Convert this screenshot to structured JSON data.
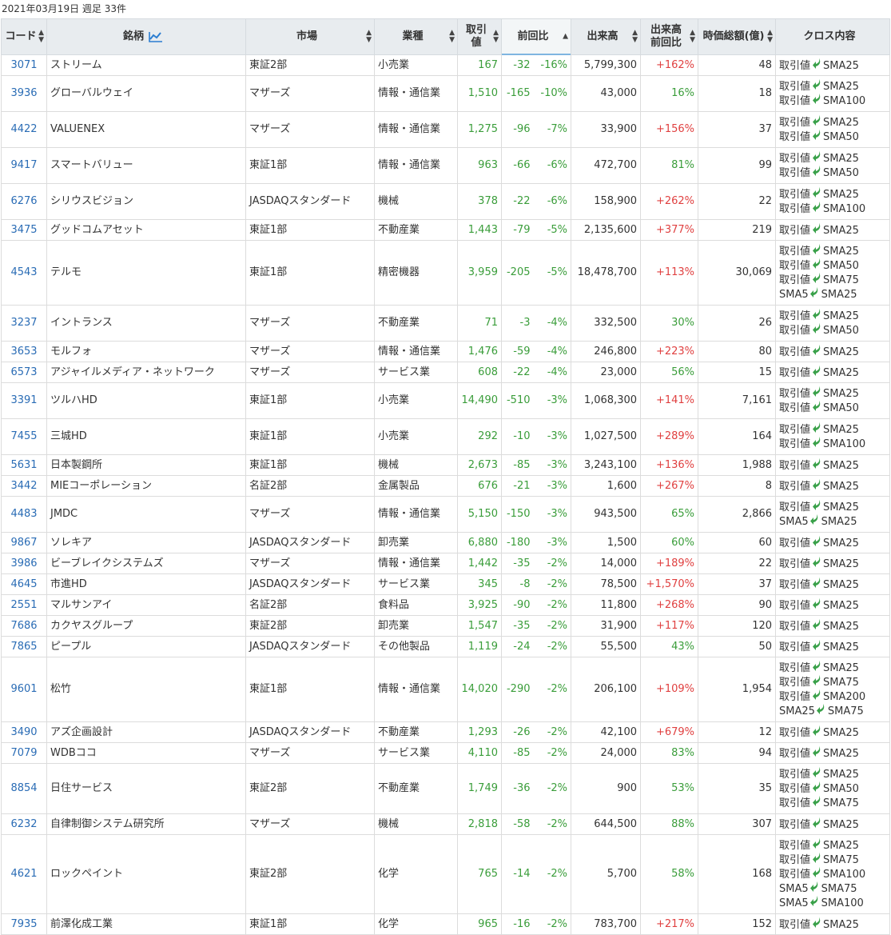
{
  "caption": "2021年03月19日 週足 33件",
  "headers": {
    "code": "コード",
    "name": "銘柄",
    "market": "市場",
    "industry": "業種",
    "price": "取引値",
    "change": "前回比",
    "volume": "出来高",
    "vol_ratio_1": "出来高",
    "vol_ratio_2": "前回比",
    "mcap": "時価総額(億)",
    "cross": "クロス内容"
  },
  "arrow_color": "#3aa14a",
  "rows": [
    {
      "code": "3071",
      "name": "ストリーム",
      "market": "東証2部",
      "industry": "小売業",
      "price": "167",
      "chg": "-32",
      "chgpct": "-16%",
      "volume": "5,799,300",
      "volratio": "+162%",
      "mcap": "48",
      "cross": [
        [
          "取引値",
          "SMA25"
        ]
      ]
    },
    {
      "code": "3936",
      "name": "グローバルウェイ",
      "market": "マザーズ",
      "industry": "情報・通信業",
      "price": "1,510",
      "chg": "-165",
      "chgpct": "-10%",
      "volume": "43,000",
      "volratio": "16%",
      "mcap": "18",
      "cross": [
        [
          "取引値",
          "SMA25"
        ],
        [
          "取引値",
          "SMA100"
        ]
      ]
    },
    {
      "code": "4422",
      "name": "VALUENEX",
      "market": "マザーズ",
      "industry": "情報・通信業",
      "price": "1,275",
      "chg": "-96",
      "chgpct": "-7%",
      "volume": "33,900",
      "volratio": "+156%",
      "mcap": "37",
      "cross": [
        [
          "取引値",
          "SMA25"
        ],
        [
          "取引値",
          "SMA50"
        ]
      ]
    },
    {
      "code": "9417",
      "name": "スマートバリュー",
      "market": "東証1部",
      "industry": "情報・通信業",
      "price": "963",
      "chg": "-66",
      "chgpct": "-6%",
      "volume": "472,700",
      "volratio": "81%",
      "mcap": "99",
      "cross": [
        [
          "取引値",
          "SMA25"
        ],
        [
          "取引値",
          "SMA50"
        ]
      ]
    },
    {
      "code": "6276",
      "name": "シリウスビジョン",
      "market": "JASDAQスタンダード",
      "industry": "機械",
      "price": "378",
      "chg": "-22",
      "chgpct": "-6%",
      "volume": "158,900",
      "volratio": "+262%",
      "mcap": "22",
      "cross": [
        [
          "取引値",
          "SMA25"
        ],
        [
          "取引値",
          "SMA100"
        ]
      ]
    },
    {
      "code": "3475",
      "name": "グッドコムアセット",
      "market": "東証1部",
      "industry": "不動産業",
      "price": "1,443",
      "chg": "-79",
      "chgpct": "-5%",
      "volume": "2,135,600",
      "volratio": "+377%",
      "mcap": "219",
      "cross": [
        [
          "取引値",
          "SMA25"
        ]
      ]
    },
    {
      "code": "4543",
      "name": "テルモ",
      "market": "東証1部",
      "industry": "精密機器",
      "price": "3,959",
      "chg": "-205",
      "chgpct": "-5%",
      "volume": "18,478,700",
      "volratio": "+113%",
      "mcap": "30,069",
      "cross": [
        [
          "取引値",
          "SMA25"
        ],
        [
          "取引値",
          "SMA50"
        ],
        [
          "取引値",
          "SMA75"
        ],
        [
          "SMA5",
          "SMA25"
        ]
      ]
    },
    {
      "code": "3237",
      "name": "イントランス",
      "market": "マザーズ",
      "industry": "不動産業",
      "price": "71",
      "chg": "-3",
      "chgpct": "-4%",
      "volume": "332,500",
      "volratio": "30%",
      "mcap": "26",
      "cross": [
        [
          "取引値",
          "SMA25"
        ],
        [
          "取引値",
          "SMA50"
        ]
      ]
    },
    {
      "code": "3653",
      "name": "モルフォ",
      "market": "マザーズ",
      "industry": "情報・通信業",
      "price": "1,476",
      "chg": "-59",
      "chgpct": "-4%",
      "volume": "246,800",
      "volratio": "+223%",
      "mcap": "80",
      "cross": [
        [
          "取引値",
          "SMA25"
        ]
      ]
    },
    {
      "code": "6573",
      "name": "アジャイルメディア・ネットワーク",
      "market": "マザーズ",
      "industry": "サービス業",
      "price": "608",
      "chg": "-22",
      "chgpct": "-4%",
      "volume": "23,000",
      "volratio": "56%",
      "mcap": "15",
      "cross": [
        [
          "取引値",
          "SMA25"
        ]
      ]
    },
    {
      "code": "3391",
      "name": "ツルハHD",
      "market": "東証1部",
      "industry": "小売業",
      "price": "14,490",
      "chg": "-510",
      "chgpct": "-3%",
      "volume": "1,068,300",
      "volratio": "+141%",
      "mcap": "7,161",
      "cross": [
        [
          "取引値",
          "SMA25"
        ],
        [
          "取引値",
          "SMA50"
        ]
      ]
    },
    {
      "code": "7455",
      "name": "三城HD",
      "market": "東証1部",
      "industry": "小売業",
      "price": "292",
      "chg": "-10",
      "chgpct": "-3%",
      "volume": "1,027,500",
      "volratio": "+289%",
      "mcap": "164",
      "cross": [
        [
          "取引値",
          "SMA25"
        ],
        [
          "取引値",
          "SMA100"
        ]
      ]
    },
    {
      "code": "5631",
      "name": "日本製鋼所",
      "market": "東証1部",
      "industry": "機械",
      "price": "2,673",
      "chg": "-85",
      "chgpct": "-3%",
      "volume": "3,243,100",
      "volratio": "+136%",
      "mcap": "1,988",
      "cross": [
        [
          "取引値",
          "SMA25"
        ]
      ]
    },
    {
      "code": "3442",
      "name": "MIEコーポレーション",
      "market": "名証2部",
      "industry": "金属製品",
      "price": "676",
      "chg": "-21",
      "chgpct": "-3%",
      "volume": "1,600",
      "volratio": "+267%",
      "mcap": "8",
      "cross": [
        [
          "取引値",
          "SMA25"
        ]
      ]
    },
    {
      "code": "4483",
      "name": "JMDC",
      "market": "マザーズ",
      "industry": "情報・通信業",
      "price": "5,150",
      "chg": "-150",
      "chgpct": "-3%",
      "volume": "943,500",
      "volratio": "65%",
      "mcap": "2,866",
      "cross": [
        [
          "取引値",
          "SMA25"
        ],
        [
          "SMA5",
          "SMA25"
        ]
      ]
    },
    {
      "code": "9867",
      "name": "ソレキア",
      "market": "JASDAQスタンダード",
      "industry": "卸売業",
      "price": "6,880",
      "chg": "-180",
      "chgpct": "-3%",
      "volume": "1,500",
      "volratio": "60%",
      "mcap": "60",
      "cross": [
        [
          "取引値",
          "SMA25"
        ]
      ]
    },
    {
      "code": "3986",
      "name": "ビーブレイクシステムズ",
      "market": "マザーズ",
      "industry": "情報・通信業",
      "price": "1,442",
      "chg": "-35",
      "chgpct": "-2%",
      "volume": "14,000",
      "volratio": "+189%",
      "mcap": "22",
      "cross": [
        [
          "取引値",
          "SMA25"
        ]
      ]
    },
    {
      "code": "4645",
      "name": "市進HD",
      "market": "JASDAQスタンダード",
      "industry": "サービス業",
      "price": "345",
      "chg": "-8",
      "chgpct": "-2%",
      "volume": "78,500",
      "volratio": "+1,570%",
      "mcap": "37",
      "cross": [
        [
          "取引値",
          "SMA25"
        ]
      ]
    },
    {
      "code": "2551",
      "name": "マルサンアイ",
      "market": "名証2部",
      "industry": "食料品",
      "price": "3,925",
      "chg": "-90",
      "chgpct": "-2%",
      "volume": "11,800",
      "volratio": "+268%",
      "mcap": "90",
      "cross": [
        [
          "取引値",
          "SMA25"
        ]
      ]
    },
    {
      "code": "7686",
      "name": "カクヤスグループ",
      "market": "東証2部",
      "industry": "卸売業",
      "price": "1,547",
      "chg": "-35",
      "chgpct": "-2%",
      "volume": "31,900",
      "volratio": "+117%",
      "mcap": "120",
      "cross": [
        [
          "取引値",
          "SMA25"
        ]
      ]
    },
    {
      "code": "7865",
      "name": "ピープル",
      "market": "JASDAQスタンダード",
      "industry": "その他製品",
      "price": "1,119",
      "chg": "-24",
      "chgpct": "-2%",
      "volume": "55,500",
      "volratio": "43%",
      "mcap": "50",
      "cross": [
        [
          "取引値",
          "SMA25"
        ]
      ]
    },
    {
      "code": "9601",
      "name": "松竹",
      "market": "東証1部",
      "industry": "情報・通信業",
      "price": "14,020",
      "chg": "-290",
      "chgpct": "-2%",
      "volume": "206,100",
      "volratio": "+109%",
      "mcap": "1,954",
      "cross": [
        [
          "取引値",
          "SMA25"
        ],
        [
          "取引値",
          "SMA75"
        ],
        [
          "取引値",
          "SMA200"
        ],
        [
          "SMA25",
          "SMA75"
        ]
      ]
    },
    {
      "code": "3490",
      "name": "アズ企画設計",
      "market": "JASDAQスタンダード",
      "industry": "不動産業",
      "price": "1,293",
      "chg": "-26",
      "chgpct": "-2%",
      "volume": "42,100",
      "volratio": "+679%",
      "mcap": "12",
      "cross": [
        [
          "取引値",
          "SMA25"
        ]
      ]
    },
    {
      "code": "7079",
      "name": "WDBココ",
      "market": "マザーズ",
      "industry": "サービス業",
      "price": "4,110",
      "chg": "-85",
      "chgpct": "-2%",
      "volume": "24,000",
      "volratio": "83%",
      "mcap": "94",
      "cross": [
        [
          "取引値",
          "SMA25"
        ]
      ]
    },
    {
      "code": "8854",
      "name": "日住サービス",
      "market": "東証2部",
      "industry": "不動産業",
      "price": "1,749",
      "chg": "-36",
      "chgpct": "-2%",
      "volume": "900",
      "volratio": "53%",
      "mcap": "35",
      "cross": [
        [
          "取引値",
          "SMA25"
        ],
        [
          "取引値",
          "SMA50"
        ],
        [
          "取引値",
          "SMA75"
        ]
      ]
    },
    {
      "code": "6232",
      "name": "自律制御システム研究所",
      "market": "マザーズ",
      "industry": "機械",
      "price": "2,818",
      "chg": "-58",
      "chgpct": "-2%",
      "volume": "644,500",
      "volratio": "88%",
      "mcap": "307",
      "cross": [
        [
          "取引値",
          "SMA25"
        ]
      ]
    },
    {
      "code": "4621",
      "name": "ロックペイント",
      "market": "東証2部",
      "industry": "化学",
      "price": "765",
      "chg": "-14",
      "chgpct": "-2%",
      "volume": "5,700",
      "volratio": "58%",
      "mcap": "168",
      "cross": [
        [
          "取引値",
          "SMA25"
        ],
        [
          "取引値",
          "SMA75"
        ],
        [
          "取引値",
          "SMA100"
        ],
        [
          "SMA5",
          "SMA75"
        ],
        [
          "SMA5",
          "SMA100"
        ]
      ]
    },
    {
      "code": "7935",
      "name": "前澤化成工業",
      "market": "東証1部",
      "industry": "化学",
      "price": "965",
      "chg": "-16",
      "chgpct": "-2%",
      "volume": "783,700",
      "volratio": "+217%",
      "mcap": "152",
      "cross": [
        [
          "取引値",
          "SMA25"
        ]
      ]
    }
  ]
}
